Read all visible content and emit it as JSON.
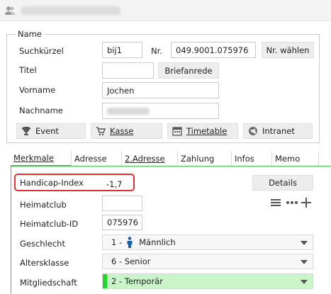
{
  "name_group": {
    "legend": "Name",
    "suchkuerzel_label": "Suchkürzel",
    "suchkuerzel_value": "bij1",
    "nr_label": "Nr.",
    "nr_value": "049.9001.075976",
    "nr_waehlen_button": "Nr. wählen",
    "titel_label": "Titel",
    "titel_value": "",
    "briefanrede_button": "Briefanrede",
    "vorname_label": "Vorname",
    "vorname_value": "Jochen",
    "nachname_label": "Nachname",
    "event_button": "Event",
    "kasse_button": "Kasse",
    "timetable_button": "Timetable",
    "intranet_button": "Intranet"
  },
  "tabs": [
    "Merkmale",
    "Adresse",
    "2.Adresse",
    "Zahlung",
    "Infos",
    "Memo"
  ],
  "merkmale": {
    "handicap_label": "Handicap-Index",
    "handicap_value": "-1,7",
    "details_button": "Details",
    "heimatclub_label": "Heimatclub",
    "heimatclub_value": "",
    "heimatclub_id_label": "Heimatclub-ID",
    "heimatclub_id_value": "075976",
    "geschlecht_label": "Geschlecht",
    "geschlecht_prefix": "1 -",
    "geschlecht_value": "Männlich",
    "altersklasse_label": "Altersklasse",
    "altersklasse_value": "6 - Senior",
    "mitgliedschaft_label": "Mitgliedschaft",
    "mitgliedschaft_value": "2 - Temporär"
  },
  "colors": {
    "accent_green": "#3cc24a",
    "highlight_red": "#e03030",
    "member_green": "#c9f5c9"
  },
  "icons": [
    "contacts-icon",
    "trophy-icon",
    "cart-icon",
    "calendar-icon",
    "globe-icon",
    "person-icon",
    "list-icon",
    "more-icon",
    "plus-icon"
  ]
}
